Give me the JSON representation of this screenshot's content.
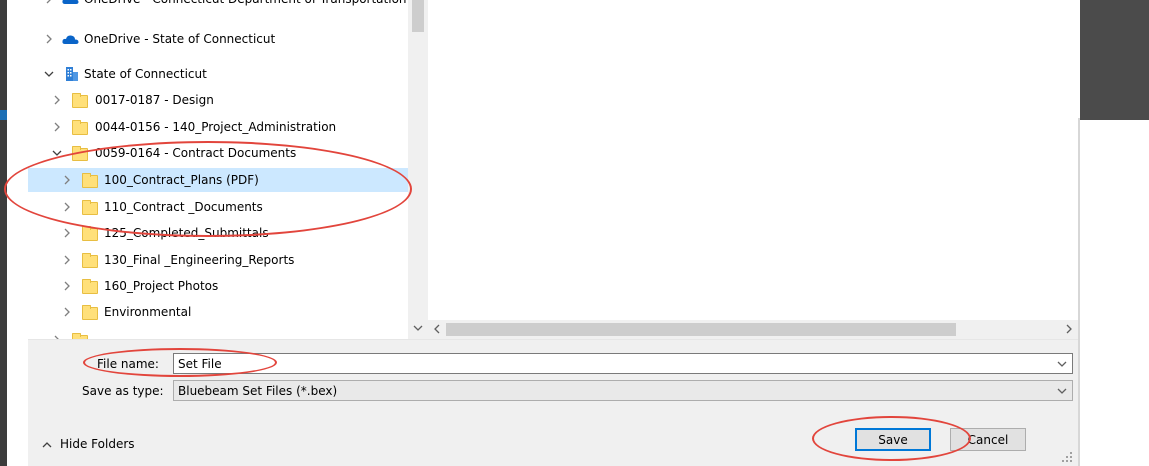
{
  "nav_tree": {
    "items": [
      {
        "label": "OneDrive - State of Connecticut",
        "icon": "onedrive-cloud-icon",
        "expanded": false,
        "selected": false
      },
      {
        "label": "State of Connecticut",
        "icon": "building-icon",
        "expanded": true,
        "selected": false
      },
      {
        "label": "0017-0187 - Design",
        "icon": "folder-icon",
        "expanded": false,
        "selected": false
      },
      {
        "label": "0044-0156 - 140_Project_Administration",
        "icon": "folder-icon",
        "expanded": false,
        "selected": false
      },
      {
        "label": "0059-0164 - Contract Documents",
        "icon": "folder-icon",
        "expanded": true,
        "selected": false
      },
      {
        "label": "100_Contract_Plans (PDF)",
        "icon": "folder-icon",
        "expanded": false,
        "selected": true
      },
      {
        "label": "110_Contract _Documents",
        "icon": "folder-icon",
        "expanded": false,
        "selected": false
      },
      {
        "label": "125_Completed_Submittals",
        "icon": "folder-icon",
        "expanded": false,
        "selected": false
      },
      {
        "label": "130_Final _Engineering_Reports",
        "icon": "folder-icon",
        "expanded": false,
        "selected": false
      },
      {
        "label": "160_Project Photos",
        "icon": "folder-icon",
        "expanded": false,
        "selected": false
      },
      {
        "label": "Environmental",
        "icon": "folder-icon",
        "expanded": false,
        "selected": false
      }
    ]
  },
  "form": {
    "file_name_label": "File name:",
    "file_name_value": "Set File",
    "save_type_label": "Save as type:",
    "save_type_value": "Bluebeam Set Files (*.bex)"
  },
  "buttons": {
    "hide_folders": "Hide Folders",
    "save": "Save",
    "cancel": "Cancel"
  },
  "colors": {
    "selection": "#cce8ff",
    "annotation": "#e2453c",
    "default_button_border": "#0078d7",
    "folder": "#ffe07a"
  }
}
